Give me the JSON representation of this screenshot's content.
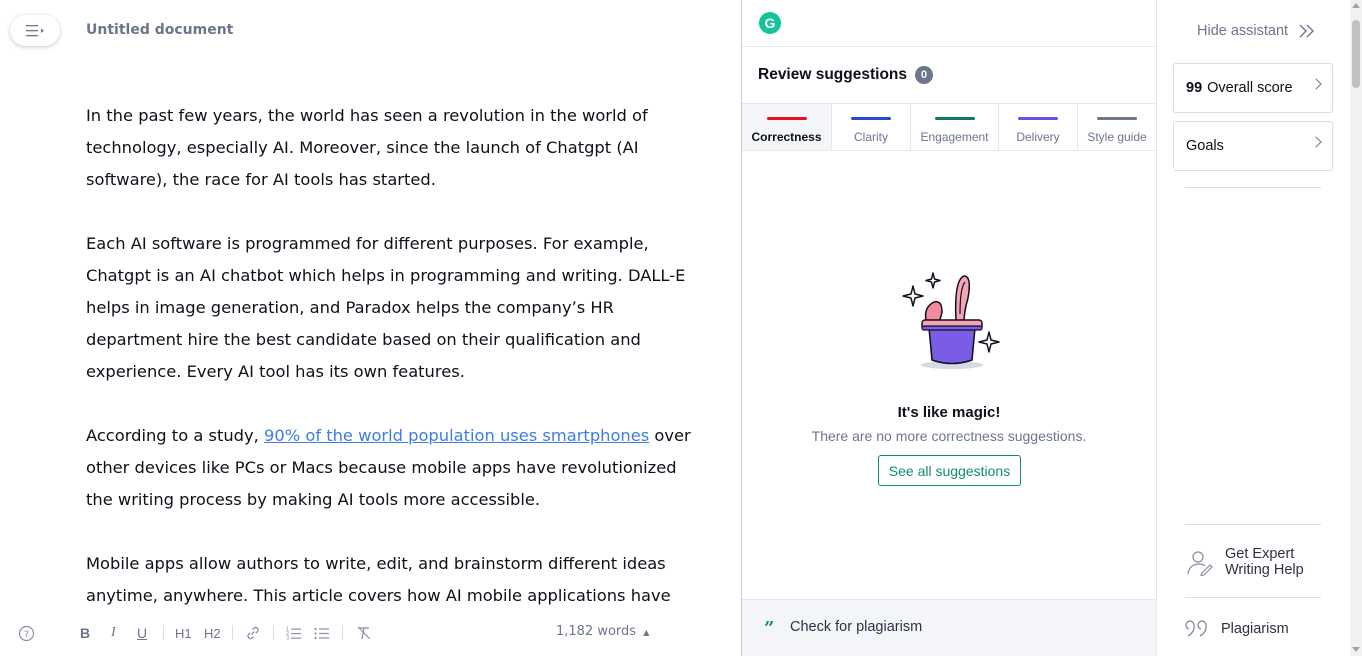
{
  "editor": {
    "title": "Untitled document",
    "paragraphs": [
      {
        "text": "In the past few years, the world has seen a revolution in the world of technology, especially AI. Moreover, since the launch of Chatgpt (AI software), the race for AI tools has started."
      },
      {
        "text": "Each AI software is programmed for different purposes. For example, Chatgpt is an AI chatbot which helps in programming and writing. DALL-E helps in image generation, and Paradox helps the company’s HR department hire the best candidate based on their qualification and experience. Every AI tool has its own features."
      },
      {
        "before": "According to a study, ",
        "link": "90% of the world population uses smartphones",
        "after": " over other devices like PCs or Macs because mobile apps have revolutionized the writing process by making AI tools more accessible."
      },
      {
        "text": "Mobile apps allow authors to write, edit, and brainstorm different ideas anytime, anywhere. This article covers how AI mobile applications have"
      }
    ],
    "toolbar": {
      "bold": "B",
      "italic": "I",
      "underline": "U",
      "h1": "H1",
      "h2": "H2",
      "word_count": "1,182 words"
    }
  },
  "panel": {
    "logo_letter": "G",
    "review_title": "Review suggestions",
    "review_count": "0",
    "tabs": [
      {
        "label": "Correctness",
        "color": "#e3111f"
      },
      {
        "label": "Clarity",
        "color": "#2a47d6"
      },
      {
        "label": "Engagement",
        "color": "#0f7566"
      },
      {
        "label": "Delivery",
        "color": "#6b4de6"
      },
      {
        "label": "Style guide",
        "color": "#6d758d"
      }
    ],
    "empty_title": "It's like magic!",
    "empty_desc": "There are no more correctness suggestions.",
    "see_all": "See all suggestions",
    "plagiarism_check": "Check for plagiarism"
  },
  "sidebar": {
    "hide_assistant": "Hide assistant",
    "overall_score_value": "99",
    "overall_score_label": "Overall score",
    "goals": "Goals",
    "expert_help": "Get Expert Writing Help",
    "plagiarism": "Plagiarism"
  },
  "colors": {
    "accent": "#0f8c73",
    "link": "#3c7ce4",
    "muted": "#6d758d"
  }
}
